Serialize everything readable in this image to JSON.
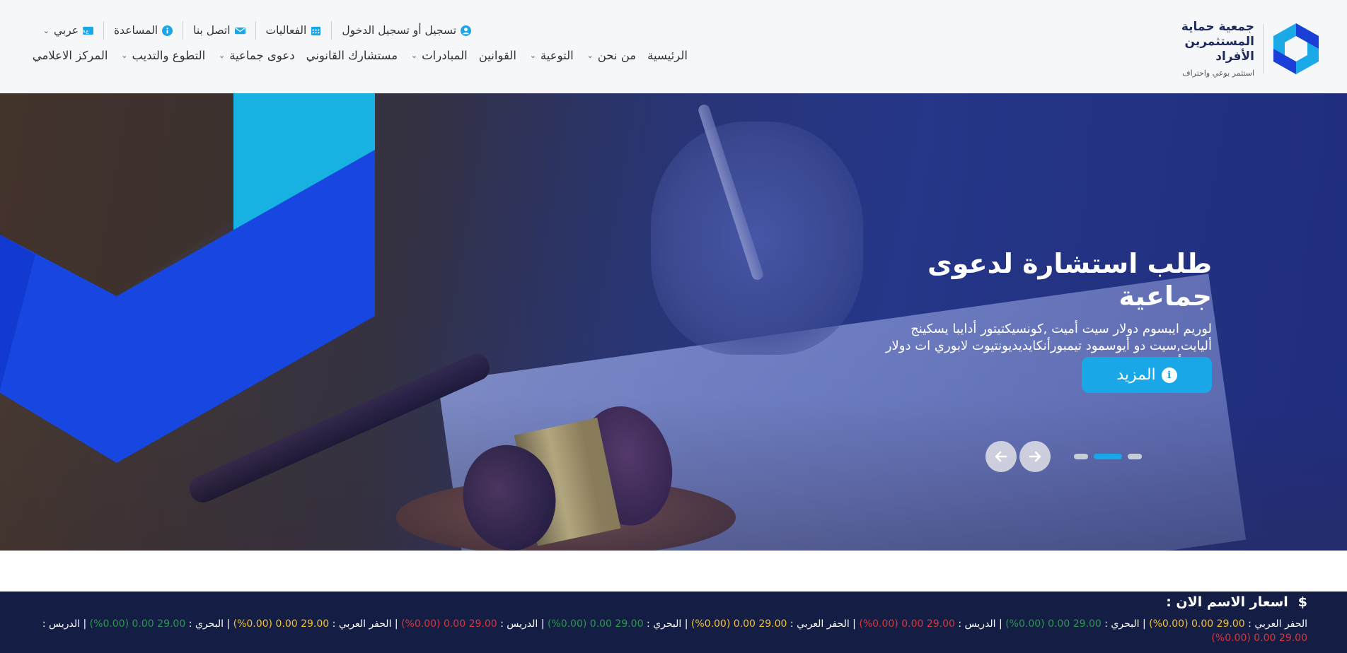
{
  "logo": {
    "name": "جمعية حماية المستثمرين الأفراد",
    "tagline": "استثمر بوعي واحتراف"
  },
  "topbar": {
    "login": "تسجيل أو تسجيل الدخول",
    "events": "الفعاليات",
    "contact": "اتصل بنا",
    "help": "المساعدة",
    "language": "عربي"
  },
  "nav": {
    "home": "الرئيسية",
    "about": "من نحن",
    "awareness": "التوعية",
    "laws": "القوانين",
    "initiatives": "المبادرات",
    "consultant": "مستشارك القانوني",
    "class_action": "دعوى جماعية",
    "volunteer": "التطوع والتديب",
    "media": "المركز الاعلامي"
  },
  "hero": {
    "title": "طلب استشارة لدعوى جماعية",
    "description": "لوريم ايبسوم دولار سيت أميت ,كونسيكتيتور أدايبا يسكينج أليايت,سيت دو أيوسمود تيمبورأنكايديديونتيوت لابوري ات دولار ماجنا أليكيوا",
    "button": "المزيد",
    "active_slide": 2,
    "slide_count": 3
  },
  "ticker": {
    "currency": "$",
    "title": "اسعار الاسم الان :",
    "entries": [
      {
        "name": "الحفر العربي",
        "price": "29.00",
        "change": "0.00",
        "pct": "(0.00%)",
        "status": "yellow"
      },
      {
        "name": "البحري",
        "price": "29.00",
        "change": "0.00",
        "pct": "(0.00%)",
        "status": "green"
      },
      {
        "name": "الدريس",
        "price": "29.00",
        "change": "0.00",
        "pct": "(0.00%)",
        "status": "red"
      },
      {
        "name": "الحفر العربي",
        "price": "29.00",
        "change": "0.00",
        "pct": "(0.00%)",
        "status": "yellow"
      },
      {
        "name": "البحري",
        "price": "29.00",
        "change": "0.00",
        "pct": "(0.00%)",
        "status": "green"
      },
      {
        "name": "الدريس",
        "price": "29.00",
        "change": "0.00",
        "pct": "(0.00%)",
        "status": "red"
      },
      {
        "name": "الحفر العربي",
        "price": "29.00",
        "change": "0.00",
        "pct": "(0.00%)",
        "status": "yellow"
      },
      {
        "name": "البحري",
        "price": "29.00",
        "change": "0.00",
        "pct": "(0.00%)",
        "status": "green"
      },
      {
        "name": "الدريس",
        "price": "29.00",
        "change": "0.00",
        "pct": "(0.00%)",
        "status": "red"
      }
    ]
  },
  "colors": {
    "accent": "#19a7e8",
    "navy": "#141d44",
    "up": "#2a9a4d",
    "down": "#d9383a",
    "flat": "#f2c230"
  }
}
